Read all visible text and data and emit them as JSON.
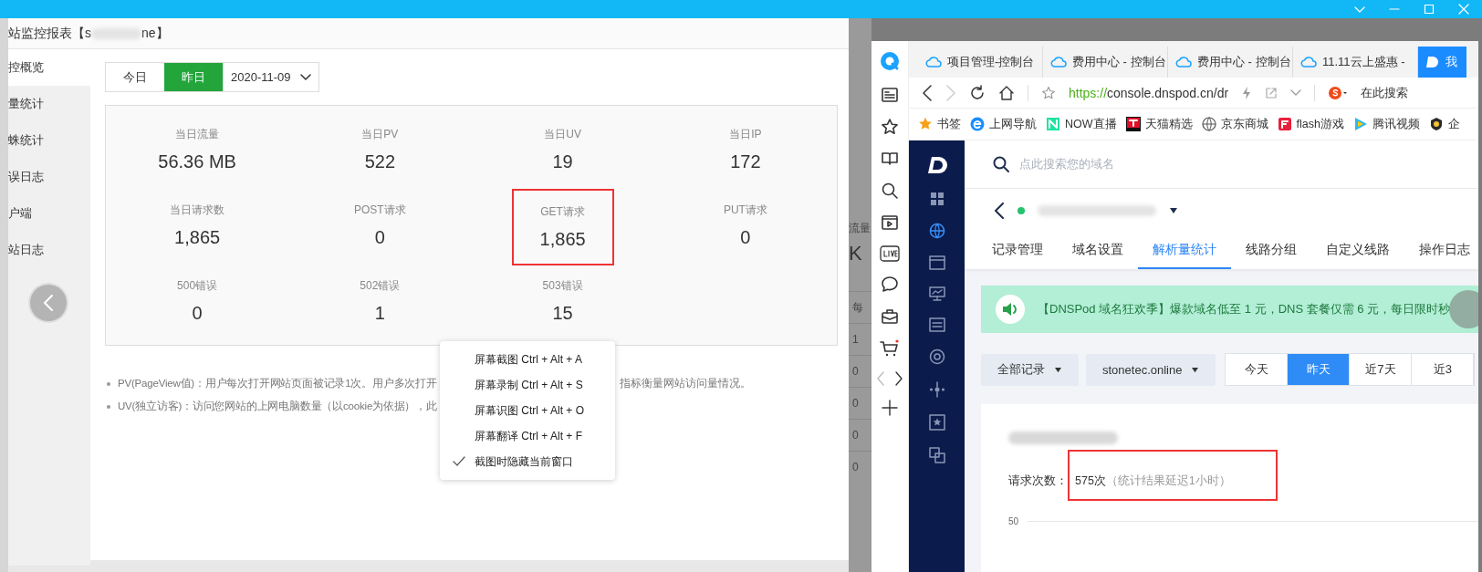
{
  "left_app": {
    "title_prefix": "站监控报表【s",
    "title_suffix": "ne】",
    "sidebar": [
      {
        "label": "控概览",
        "selected": true
      },
      {
        "label": "量统计",
        "selected": false
      },
      {
        "label": "蛛统计",
        "selected": false
      },
      {
        "label": "误日志",
        "selected": false
      },
      {
        "label": "户端",
        "selected": false
      },
      {
        "label": "站日志",
        "selected": false
      }
    ],
    "day_toggle": [
      {
        "label": "今日",
        "selected": false
      },
      {
        "label": "昨日",
        "selected": true
      }
    ],
    "date_select": "2020-11-09",
    "stats": [
      {
        "label": "当日流量",
        "value": "56.36 MB",
        "highlighted": false
      },
      {
        "label": "当日PV",
        "value": "522",
        "highlighted": false
      },
      {
        "label": "当日UV",
        "value": "19",
        "highlighted": false
      },
      {
        "label": "当日IP",
        "value": "172",
        "highlighted": false
      },
      {
        "label": "当日请求数",
        "value": "1,865",
        "highlighted": false
      },
      {
        "label": "POST请求",
        "value": "0",
        "highlighted": false
      },
      {
        "label": "GET请求",
        "value": "1,865",
        "highlighted": true
      },
      {
        "label": "PUT请求",
        "value": "0",
        "highlighted": false
      },
      {
        "label": "500错误",
        "value": "0",
        "highlighted": false
      },
      {
        "label": "502错误",
        "value": "1",
        "highlighted": false
      },
      {
        "label": "503错误",
        "value": "15",
        "highlighted": false
      }
    ],
    "notes": [
      {
        "parts": [
          "PV(PageView值)：用户每次打开网站页面被记录1次。用户多次打开",
          "指标衡量网站访问量情况。"
        ]
      },
      {
        "parts": [
          "UV(独立访客)：访问您网站的上网电脑数量（以cookie为依据），此"
        ]
      }
    ]
  },
  "context_menu": {
    "items": [
      {
        "label": "屏幕截图 Ctrl + Alt + A",
        "checked": false
      },
      {
        "label": "屏幕录制 Ctrl + Alt + S",
        "checked": false
      },
      {
        "label": "屏幕识图 Ctrl + Alt + O",
        "checked": false
      },
      {
        "label": "屏幕翻译 Ctrl + Alt + F",
        "checked": false
      },
      {
        "label": "截图时隐藏当前窗口",
        "checked": true
      }
    ]
  },
  "background_window": {
    "label": "流量",
    "value": "K",
    "column_header": "每",
    "column": [
      "1",
      "0",
      "0",
      "0",
      "0"
    ]
  },
  "browser": {
    "tabs": [
      {
        "label": "项目管理-控制台",
        "selected": false
      },
      {
        "label": "费用中心 - 控制台",
        "selected": false
      },
      {
        "label": "费用中心 - 控制台",
        "selected": false
      },
      {
        "label": "11.11云上盛惠 -",
        "selected": false
      },
      {
        "label": "我",
        "selected": true
      }
    ],
    "url_scheme": "https://",
    "url_rest": "console.dnspod.cn/dr",
    "search_placeholder": "在此搜索",
    "bookmarks": [
      {
        "label": "书签",
        "kind": "star"
      },
      {
        "label": "上网导航",
        "kind": "ie"
      },
      {
        "label": "NOW直播",
        "kind": "now"
      },
      {
        "label": "天猫精选",
        "kind": "tmall"
      },
      {
        "label": "京东商城",
        "kind": "globe"
      },
      {
        "label": "flash游戏",
        "kind": "flash"
      },
      {
        "label": "腾讯视频",
        "kind": "video"
      },
      {
        "label": "企",
        "kind": "badge"
      }
    ]
  },
  "dnspod": {
    "search_placeholder": "点此搜索您的域名",
    "nav_tabs": [
      {
        "label": "记录管理",
        "selected": false
      },
      {
        "label": "域名设置",
        "selected": false
      },
      {
        "label": "解析量统计",
        "selected": true
      },
      {
        "label": "线路分组",
        "selected": false
      },
      {
        "label": "自定义线路",
        "selected": false
      },
      {
        "label": "操作日志",
        "selected": false
      }
    ],
    "banner": "【DNSPod 域名狂欢季】爆款域名低至 1 元，DNS 套餐仅需 6 元，每日限时秒",
    "filters": [
      "全部记录",
      "stonetec.online"
    ],
    "ranges": [
      {
        "label": "今天",
        "selected": false
      },
      {
        "label": "昨天",
        "selected": true
      },
      {
        "label": "近7天",
        "selected": false
      },
      {
        "label": "近3",
        "selected": false
      }
    ],
    "request_label": "请求次数：",
    "request_value": "575次",
    "request_note": "（统计结果延迟1小时）",
    "y_tick": "50"
  }
}
